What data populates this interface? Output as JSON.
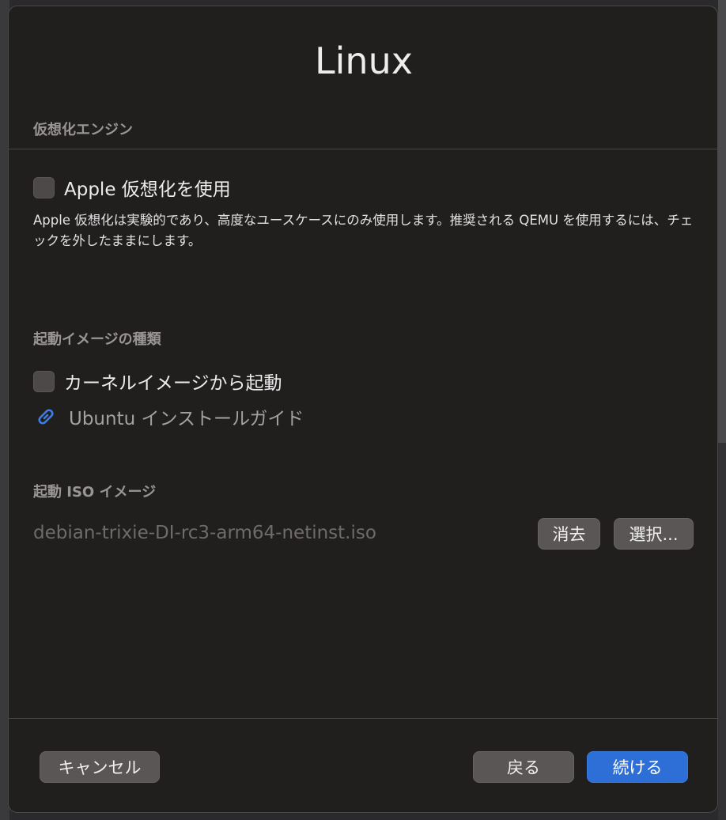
{
  "dialog": {
    "title": "Linux",
    "sections": {
      "engine": {
        "label": "仮想化エンジン"
      },
      "boot_type": {
        "label": "起動イメージの種類"
      },
      "boot_iso": {
        "label": "起動 ISO イメージ"
      }
    },
    "apple_virtualization": {
      "label": "Apple 仮想化を使用",
      "checked": false,
      "description": "Apple 仮想化は実験的であり、高度なユースケースにのみ使用します。推奨される QEMU を使用するには、チェックを外したままにします。"
    },
    "kernel_boot": {
      "label": "カーネルイメージから起動",
      "checked": false
    },
    "guide_link": {
      "icon": "link-icon",
      "label": "Ubuntu インストールガイド"
    },
    "iso": {
      "filename": "debian-trixie-DI-rc3-arm64-netinst.iso",
      "clear_label": "消去",
      "browse_label": "選択..."
    },
    "footer": {
      "cancel_label": "キャンセル",
      "back_label": "戻る",
      "continue_label": "続ける"
    }
  },
  "colors": {
    "sheet_background": "#211e1e",
    "primary_button": "#2d6fd6",
    "link_icon": "#3b7ee8"
  }
}
